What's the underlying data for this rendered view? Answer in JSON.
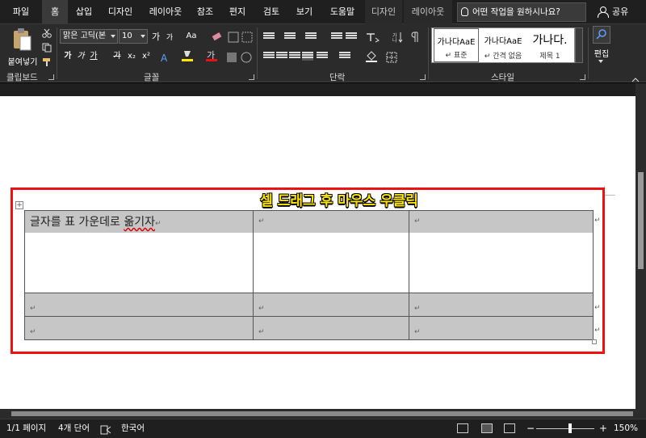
{
  "tabs": [
    {
      "label": "파일"
    },
    {
      "label": "홈"
    },
    {
      "label": "삽입"
    },
    {
      "label": "디자인"
    },
    {
      "label": "레이아웃"
    },
    {
      "label": "참조"
    },
    {
      "label": "편지"
    },
    {
      "label": "검토"
    },
    {
      "label": "보기"
    },
    {
      "label": "도움말"
    },
    {
      "label": "디자인"
    },
    {
      "label": "레이아웃"
    }
  ],
  "tell_me": "어떤 작업을 원하시나요?",
  "share": "공유",
  "ribbon": {
    "paste": "붙여넣기",
    "font_name": "맑은 고딕(본",
    "font_size": "10",
    "grow": "가",
    "shrink": "가",
    "case": "Aa",
    "bold": "가",
    "italic": "가",
    "underline": "가",
    "strike": "가",
    "sub": "x₂",
    "sup": "x²",
    "groups": {
      "clipboard": "클립보드",
      "font": "글꼴",
      "paragraph": "단락",
      "styles": "스타일",
      "editing": "편집"
    },
    "styles": [
      {
        "sample": "가나다AaE",
        "name": "↵ 표준"
      },
      {
        "sample": "가나다AaE",
        "name": "↵ 간격 없음"
      },
      {
        "sample": "가나다.",
        "name": "제목 1"
      }
    ]
  },
  "document": {
    "annotation": "셀 드래그 후 마우스 우클릭",
    "cell_text": "글자를 표 가운데로 ",
    "cell_text_wavy": "옮기자",
    "paragraph_mark": "↵"
  },
  "status": {
    "page": "1/1 페이지",
    "words": "4개 단어",
    "language": "한국어",
    "zoom": "150%",
    "zoom_level": 0.58
  }
}
